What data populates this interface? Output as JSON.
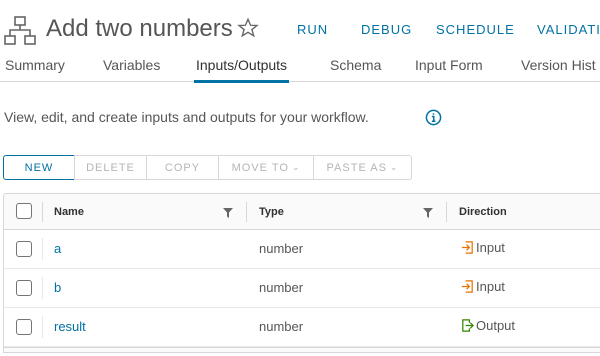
{
  "header": {
    "title": "Add two numbers",
    "actions": [
      "RUN",
      "DEBUG",
      "SCHEDULE",
      "VALIDATI"
    ]
  },
  "tabs": [
    "Summary",
    "Variables",
    "Inputs/Outputs",
    "Schema",
    "Input Form",
    "Version Hist"
  ],
  "active_tab": "Inputs/Outputs",
  "description": "View, edit, and create inputs and outputs for your workflow.",
  "toolbar": {
    "new_label": "NEW",
    "delete_label": "DELETE",
    "copy_label": "COPY",
    "move_to_label": "MOVE TO",
    "paste_as_label": "PASTE AS"
  },
  "grid": {
    "columns": [
      "Name",
      "Type",
      "Direction"
    ],
    "rows": [
      {
        "name": "a",
        "type": "number",
        "direction": "Input"
      },
      {
        "name": "b",
        "type": "number",
        "direction": "Input"
      },
      {
        "name": "result",
        "type": "number",
        "direction": "Output"
      }
    ]
  },
  "colors": {
    "accent": "#0072a3",
    "input_icon": "#e57200",
    "output_icon": "#2f8400"
  },
  "icons": {
    "workflow": "workflow-hierarchy-icon",
    "favorite": "star-icon",
    "info": "info-icon",
    "filter": "filter-icon",
    "input": "input-arrow-icon",
    "output": "output-arrow-icon"
  }
}
